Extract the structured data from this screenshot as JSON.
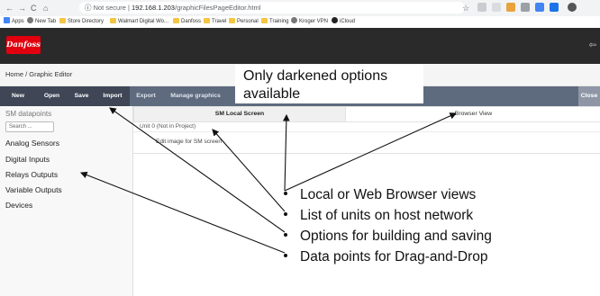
{
  "browser": {
    "security_label": "Not secure",
    "url_host": "192.168.1.203",
    "url_path": "/graphicFilesPageEditor.html",
    "bookmarks": [
      "Apps",
      "New Tab",
      "Store Directory",
      "Walmart Digital Wo...",
      "Danfoss",
      "Travel",
      "Personal",
      "Training",
      "Kroger VPN",
      "iCloud"
    ]
  },
  "app": {
    "brand": "Danfoss",
    "breadcrumb": "Home / Graphic Editor"
  },
  "toolbar": {
    "new": "New",
    "open": "Open",
    "save": "Save",
    "import": "Import",
    "export": "Export",
    "manage": "Manage graphics",
    "close": "Close"
  },
  "sidebar": {
    "title": "SM datapoints",
    "search_placeholder": "Search ...",
    "items": [
      "Analog Sensors",
      "Digital Inputs",
      "Relays Outputs",
      "Variable Outputs",
      "Devices"
    ]
  },
  "main": {
    "tabs": [
      "SM Local Screen",
      "Browser View"
    ],
    "unit_label": "Unit 0 (Not in Project)",
    "edit_label": "Edit image for SM screen"
  },
  "annotations": {
    "callout_line1": "Only darkened options",
    "callout_line2": "available",
    "notes": [
      "Local or Web Browser views",
      "List of units on host network",
      "Options for building and saving",
      "Data points for Drag-and-Drop"
    ]
  },
  "colors": {
    "brand_red": "#e2000f",
    "toolbar": "#5e6b7e",
    "toolbar_active": "#3f4756"
  }
}
